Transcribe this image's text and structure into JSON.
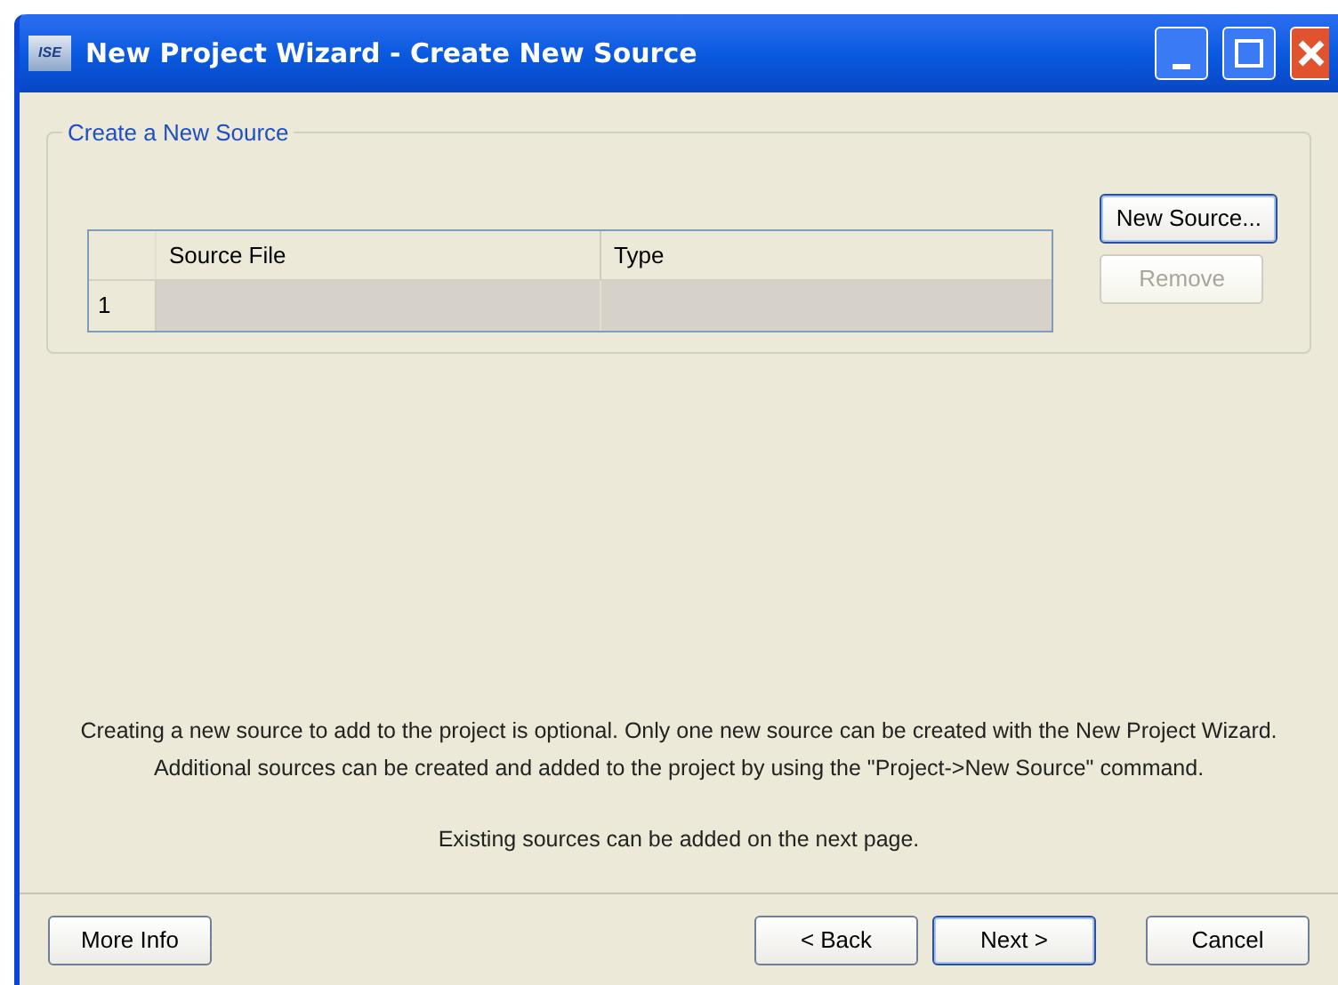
{
  "window": {
    "title": "New Project Wizard - Create New Source",
    "app_badge": "ISE"
  },
  "group": {
    "title": "Create a New Source"
  },
  "table": {
    "columns": [
      "Source File",
      "Type"
    ],
    "rows": [
      {
        "number": "1",
        "cells": [
          "",
          ""
        ],
        "selected": true
      }
    ]
  },
  "side_buttons": [
    {
      "label": "New Source...",
      "disabled": false,
      "focused": true
    },
    {
      "label": "Remove",
      "disabled": true,
      "focused": false
    }
  ],
  "description": "Creating a new source to add to the project is optional. Only one new source can be created with the New Project Wizard. Additional sources can be created and added to the project by using the \"Project->New Source\" command.",
  "note": "Existing sources can be added on the next page.",
  "footer_buttons": [
    {
      "label": "More Info",
      "focused": false
    },
    {
      "label": "< Back",
      "focused": false
    },
    {
      "label": "Next >",
      "focused": true
    },
    {
      "label": "Cancel",
      "focused": false
    }
  ]
}
